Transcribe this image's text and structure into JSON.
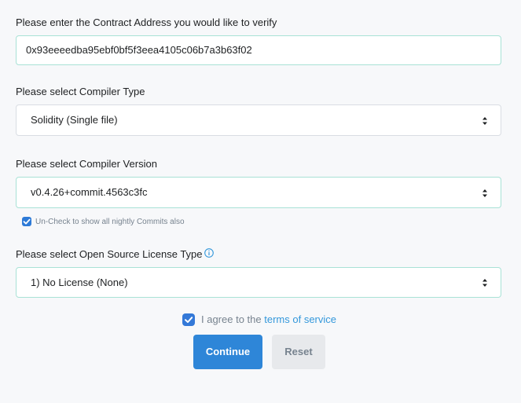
{
  "form": {
    "contract_address": {
      "label": "Please enter the Contract Address you would like to verify",
      "value": "0x93eeeedba95ebf0bf5f3eea4105c06b7a3b63f02"
    },
    "compiler_type": {
      "label": "Please select Compiler Type",
      "selected": "Solidity (Single file)"
    },
    "compiler_version": {
      "label": "Please select Compiler Version",
      "selected": "v0.4.26+commit.4563c3fc",
      "nightly_checkbox_label": "Un-Check to show all nightly Commits also",
      "nightly_checked": true
    },
    "license_type": {
      "label": "Please select Open Source License Type",
      "selected": "1) No License (None)"
    },
    "agreement": {
      "prefix": "I agree to the",
      "link_text": "terms of service",
      "checked": true
    },
    "buttons": {
      "continue": "Continue",
      "reset": "Reset"
    }
  },
  "colors": {
    "primary": "#2e86d8",
    "link": "#3498db",
    "focus_border": "#a9e2d6",
    "background": "#f7f8fa"
  },
  "icons": {
    "select_arrow": "chevron-up-down-icon",
    "info": "info-circle-icon",
    "check": "check-icon"
  }
}
